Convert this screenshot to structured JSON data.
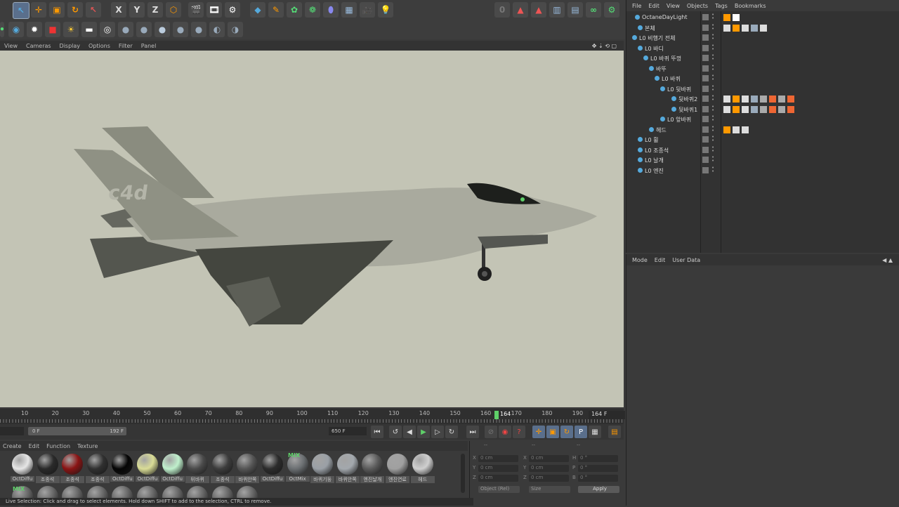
{
  "viewport_menu": [
    "View",
    "Cameras",
    "Display",
    "Options",
    "Filter",
    "Panel"
  ],
  "viewport": {
    "tail_text": "c4d"
  },
  "timeline": {
    "ticks": [
      "10",
      "20",
      "30",
      "40",
      "50",
      "60",
      "70",
      "80",
      "90",
      "100",
      "110",
      "120",
      "130",
      "140",
      "150",
      "160",
      "170",
      "180",
      "190"
    ],
    "current_frame": "164",
    "end_field": "164 F",
    "start_field": "0 F",
    "range_field": "192 F",
    "max_field": "650 F"
  },
  "materials_menu": [
    "Create",
    "Edit",
    "Function",
    "Texture"
  ],
  "materials": [
    {
      "label": "OctDiffu",
      "color": "#e6e6e6"
    },
    {
      "label": "조종석",
      "color": "#2a2a2a"
    },
    {
      "label": "조종석",
      "color": "#8a1414"
    },
    {
      "label": "조종석",
      "color": "#303030"
    },
    {
      "label": "OctDiffu",
      "color": "#050505"
    },
    {
      "label": "OctDiffu",
      "color": "#d9dc96"
    },
    {
      "label": "OctDiffu",
      "color": "#bff0cc"
    },
    {
      "label": "뒤바퀴",
      "color": "#4a4a4a"
    },
    {
      "label": "조종석",
      "color": "#3c3c3c"
    },
    {
      "label": "바퀴안쪽",
      "color": "#555"
    },
    {
      "label": "OctDiffu",
      "color": "#2c2c2c"
    },
    {
      "label": "OctMix",
      "color": "#6b6f72"
    },
    {
      "label": "바퀴기둥",
      "color": "#9aa0a6"
    },
    {
      "label": "바퀴안쪽",
      "color": "#a3a8ad"
    },
    {
      "label": "엔진날개",
      "color": "#5a5a5a"
    },
    {
      "label": "엔진연료",
      "color": "#a0a0a0"
    },
    {
      "label": "헤드",
      "color": "#cfcfcf"
    }
  ],
  "mix_label": "MIX",
  "coords": {
    "headers": [
      "--",
      "--",
      "--"
    ],
    "rows": [
      {
        "a": "X",
        "av": "0 cm",
        "b": "X",
        "bv": "0 cm",
        "c": "H",
        "cv": "0 °"
      },
      {
        "a": "Y",
        "av": "0 cm",
        "b": "Y",
        "bv": "0 cm",
        "c": "P",
        "cv": "0 °"
      },
      {
        "a": "Z",
        "av": "0 cm",
        "b": "Z",
        "bv": "0 cm",
        "c": "B",
        "cv": "0 °"
      }
    ],
    "mode_select": "Object (Rel)",
    "size_select": "Size",
    "apply": "Apply"
  },
  "object_menu": [
    "File",
    "Edit",
    "View",
    "Objects",
    "Tags",
    "Bookmarks"
  ],
  "objects": [
    {
      "name": "OctaneDayLight",
      "indent": 10
    },
    {
      "name": "본체",
      "indent": 14
    },
    {
      "name": "L0 비행기 전체",
      "indent": 6
    },
    {
      "name": "L0 바디",
      "indent": 14
    },
    {
      "name": "L0 바퀴 뚜껑",
      "indent": 22
    },
    {
      "name": "바뚜",
      "indent": 30
    },
    {
      "name": "L0 바퀴",
      "indent": 38
    },
    {
      "name": "L0 뒷바퀴",
      "indent": 46
    },
    {
      "name": "뒷바퀴2",
      "indent": 62
    },
    {
      "name": "뒷바퀴1",
      "indent": 62
    },
    {
      "name": "L0 앞바퀴",
      "indent": 46
    },
    {
      "name": "헤드",
      "indent": 30
    },
    {
      "name": "L0 휠",
      "indent": 14
    },
    {
      "name": "L0 조종석",
      "indent": 14
    },
    {
      "name": "L0 날개",
      "indent": 14
    },
    {
      "name": "L0 엔진",
      "indent": 14
    }
  ],
  "attr_menu": [
    "Mode",
    "Edit",
    "User Data"
  ],
  "status": "Live Selection: Click and drag to select elements. Hold down SHIFT to add to the selection, CTRL to remove.",
  "colors": {
    "accent": "#5fd069",
    "frame_bg": "#c3c4b5",
    "panel": "#323232"
  }
}
